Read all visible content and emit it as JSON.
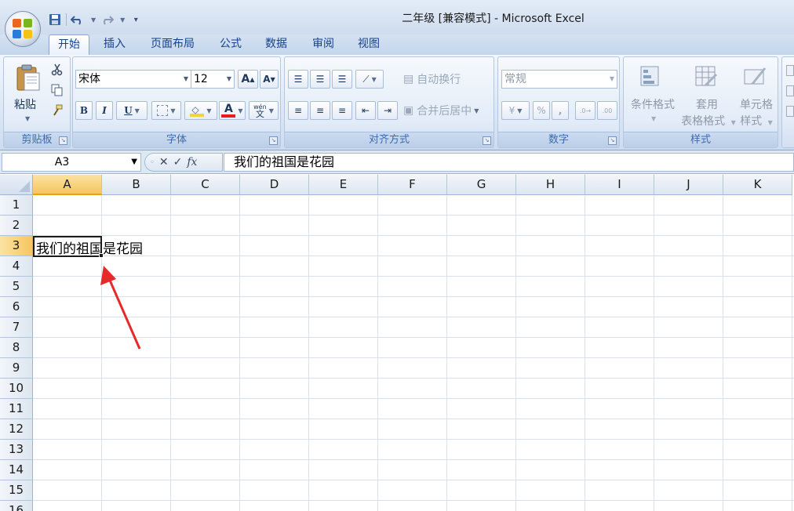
{
  "window": {
    "title": "二年级  [兼容模式] - Microsoft Excel"
  },
  "quick_access": {
    "items": [
      "save-icon",
      "undo-icon",
      "redo-icon",
      "customize-icon"
    ]
  },
  "tabs": [
    {
      "label": "开始",
      "active": true
    },
    {
      "label": "插入"
    },
    {
      "label": "页面布局"
    },
    {
      "label": "公式"
    },
    {
      "label": "数据"
    },
    {
      "label": "审阅"
    },
    {
      "label": "视图"
    }
  ],
  "ribbon": {
    "clipboard": {
      "paste_label": "粘贴",
      "group_label": "剪贴板"
    },
    "font": {
      "font_name": "宋体",
      "font_size": "12",
      "bold": "B",
      "italic": "I",
      "underline": "U",
      "font_color_glyph": "A",
      "phonetic_glyph": "wén",
      "phonetic_char": "文",
      "grow_glyph": "A",
      "shrink_glyph": "A",
      "group_label": "字体",
      "font_color": "#e81c1c",
      "fill_color": "#f3d23a"
    },
    "alignment": {
      "wrap_text": "自动换行",
      "merge_center": "合并后居中",
      "group_label": "对齐方式"
    },
    "number": {
      "format": "常规",
      "percent": "%",
      "comma": ",",
      "inc_decimal": "←.0\n.00",
      "dec_decimal": ".00\n→.0",
      "group_label": "数字"
    },
    "styles": {
      "conditional": "条件格式",
      "table_format_1": "套用",
      "table_format_2": "表格格式",
      "cell_style_1": "单元格",
      "cell_style_2": "样式",
      "group_label": "样式"
    }
  },
  "formula_bar": {
    "name_box": "A3",
    "cancel": "✕",
    "enter": "✓",
    "fx": "fx",
    "content": "我们的祖国是花园"
  },
  "sheet": {
    "columns": [
      "A",
      "B",
      "C",
      "D",
      "E",
      "F",
      "G",
      "H",
      "I",
      "J",
      "K"
    ],
    "rows": [
      "1",
      "2",
      "3",
      "4",
      "5",
      "6",
      "7",
      "8",
      "9",
      "10",
      "11",
      "12",
      "13",
      "14",
      "15",
      "16"
    ],
    "selected_cell": "A3",
    "cell_A3": "我们的祖国是花园"
  },
  "colors": {
    "selection_header": "#f7c55e",
    "annotation_arrow": "#e52a2a"
  }
}
